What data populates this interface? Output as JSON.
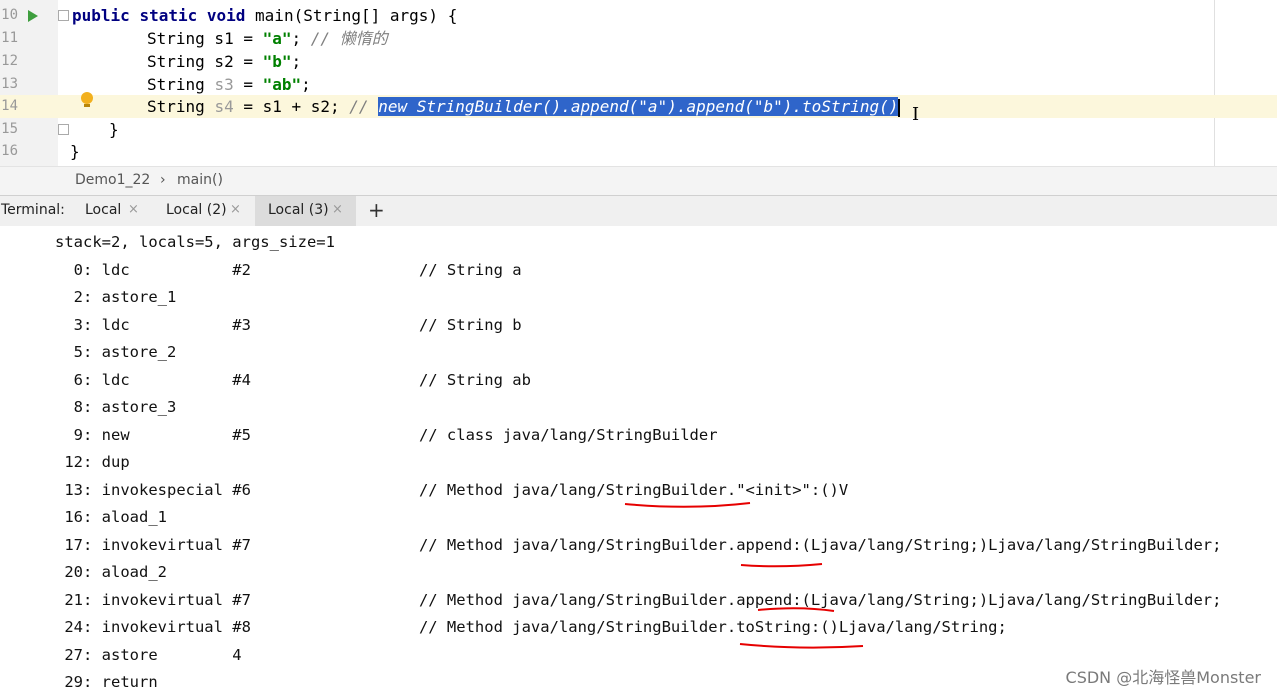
{
  "editor": {
    "lines": [
      {
        "num": "10",
        "text": "public static void main(String[] args) {"
      },
      {
        "num": "11",
        "code": "String s1 = ",
        "value": "\"a\"",
        "end": ";",
        "comment": "// 懒惰的"
      },
      {
        "num": "12",
        "code": "String s2 = ",
        "value": "\"b\"",
        "end": ";"
      },
      {
        "num": "13",
        "code": "String ",
        "var": "s3",
        "mid": " = ",
        "value": "\"ab\"",
        "end": ";"
      },
      {
        "num": "14",
        "code": "String ",
        "var": "s4",
        "mid": " = s1 + s2; ",
        "comment_prefix": "// ",
        "selected": "new StringBuilder().append(\"a\").append(\"b\").toString()"
      },
      {
        "num": "15",
        "text": "}"
      },
      {
        "num": "16",
        "text": "}"
      }
    ],
    "keywords": {
      "public": "public",
      "static": "static",
      "void": "void"
    },
    "rest_line10": " main(String[] args) {"
  },
  "breadcrumb": {
    "file": "Demo1_22",
    "sep": "›",
    "method": "main()"
  },
  "terminal": {
    "label": "Terminal:",
    "tabs": [
      {
        "label": "Local",
        "active": false
      },
      {
        "label": "Local (2)",
        "active": false
      },
      {
        "label": "Local (3)",
        "active": true
      }
    ],
    "close_glyph": "×",
    "add_glyph": "+",
    "lines": [
      "stack=2, locals=5, args_size=1",
      "  0: ldc           #2                  // String a",
      "  2: astore_1",
      "  3: ldc           #3                  // String b",
      "  5: astore_2",
      "  6: ldc           #4                  // String ab",
      "  8: astore_3",
      "  9: new           #5                  // class java/lang/StringBuilder",
      " 12: dup",
      " 13: invokespecial #6                  // Method java/lang/StringBuilder.\"<init>\":()V",
      " 16: aload_1",
      " 17: invokevirtual #7                  // Method java/lang/StringBuilder.append:(Ljava/lang/String;)Ljava/lang/StringBuilder;",
      " 20: aload_2",
      " 21: invokevirtual #7                  // Method java/lang/StringBuilder.append:(Ljava/lang/String;)Ljava/lang/StringBuilder;",
      " 24: invokevirtual #8                  // Method java/lang/StringBuilder.toString:()Ljava/lang/String;",
      " 27: astore        4",
      " 29: return"
    ]
  },
  "watermark": "CSDN @北海怪兽Monster",
  "colors": {
    "selection": "#2f65ca",
    "current_line": "#fcf7dc",
    "keyword": "#000080",
    "string": "#008000",
    "annotation": "#e60000"
  },
  "icons": [
    "run-icon",
    "lightbulb-icon",
    "fold-icon",
    "close-icon",
    "add-icon",
    "text-cursor-icon"
  ]
}
